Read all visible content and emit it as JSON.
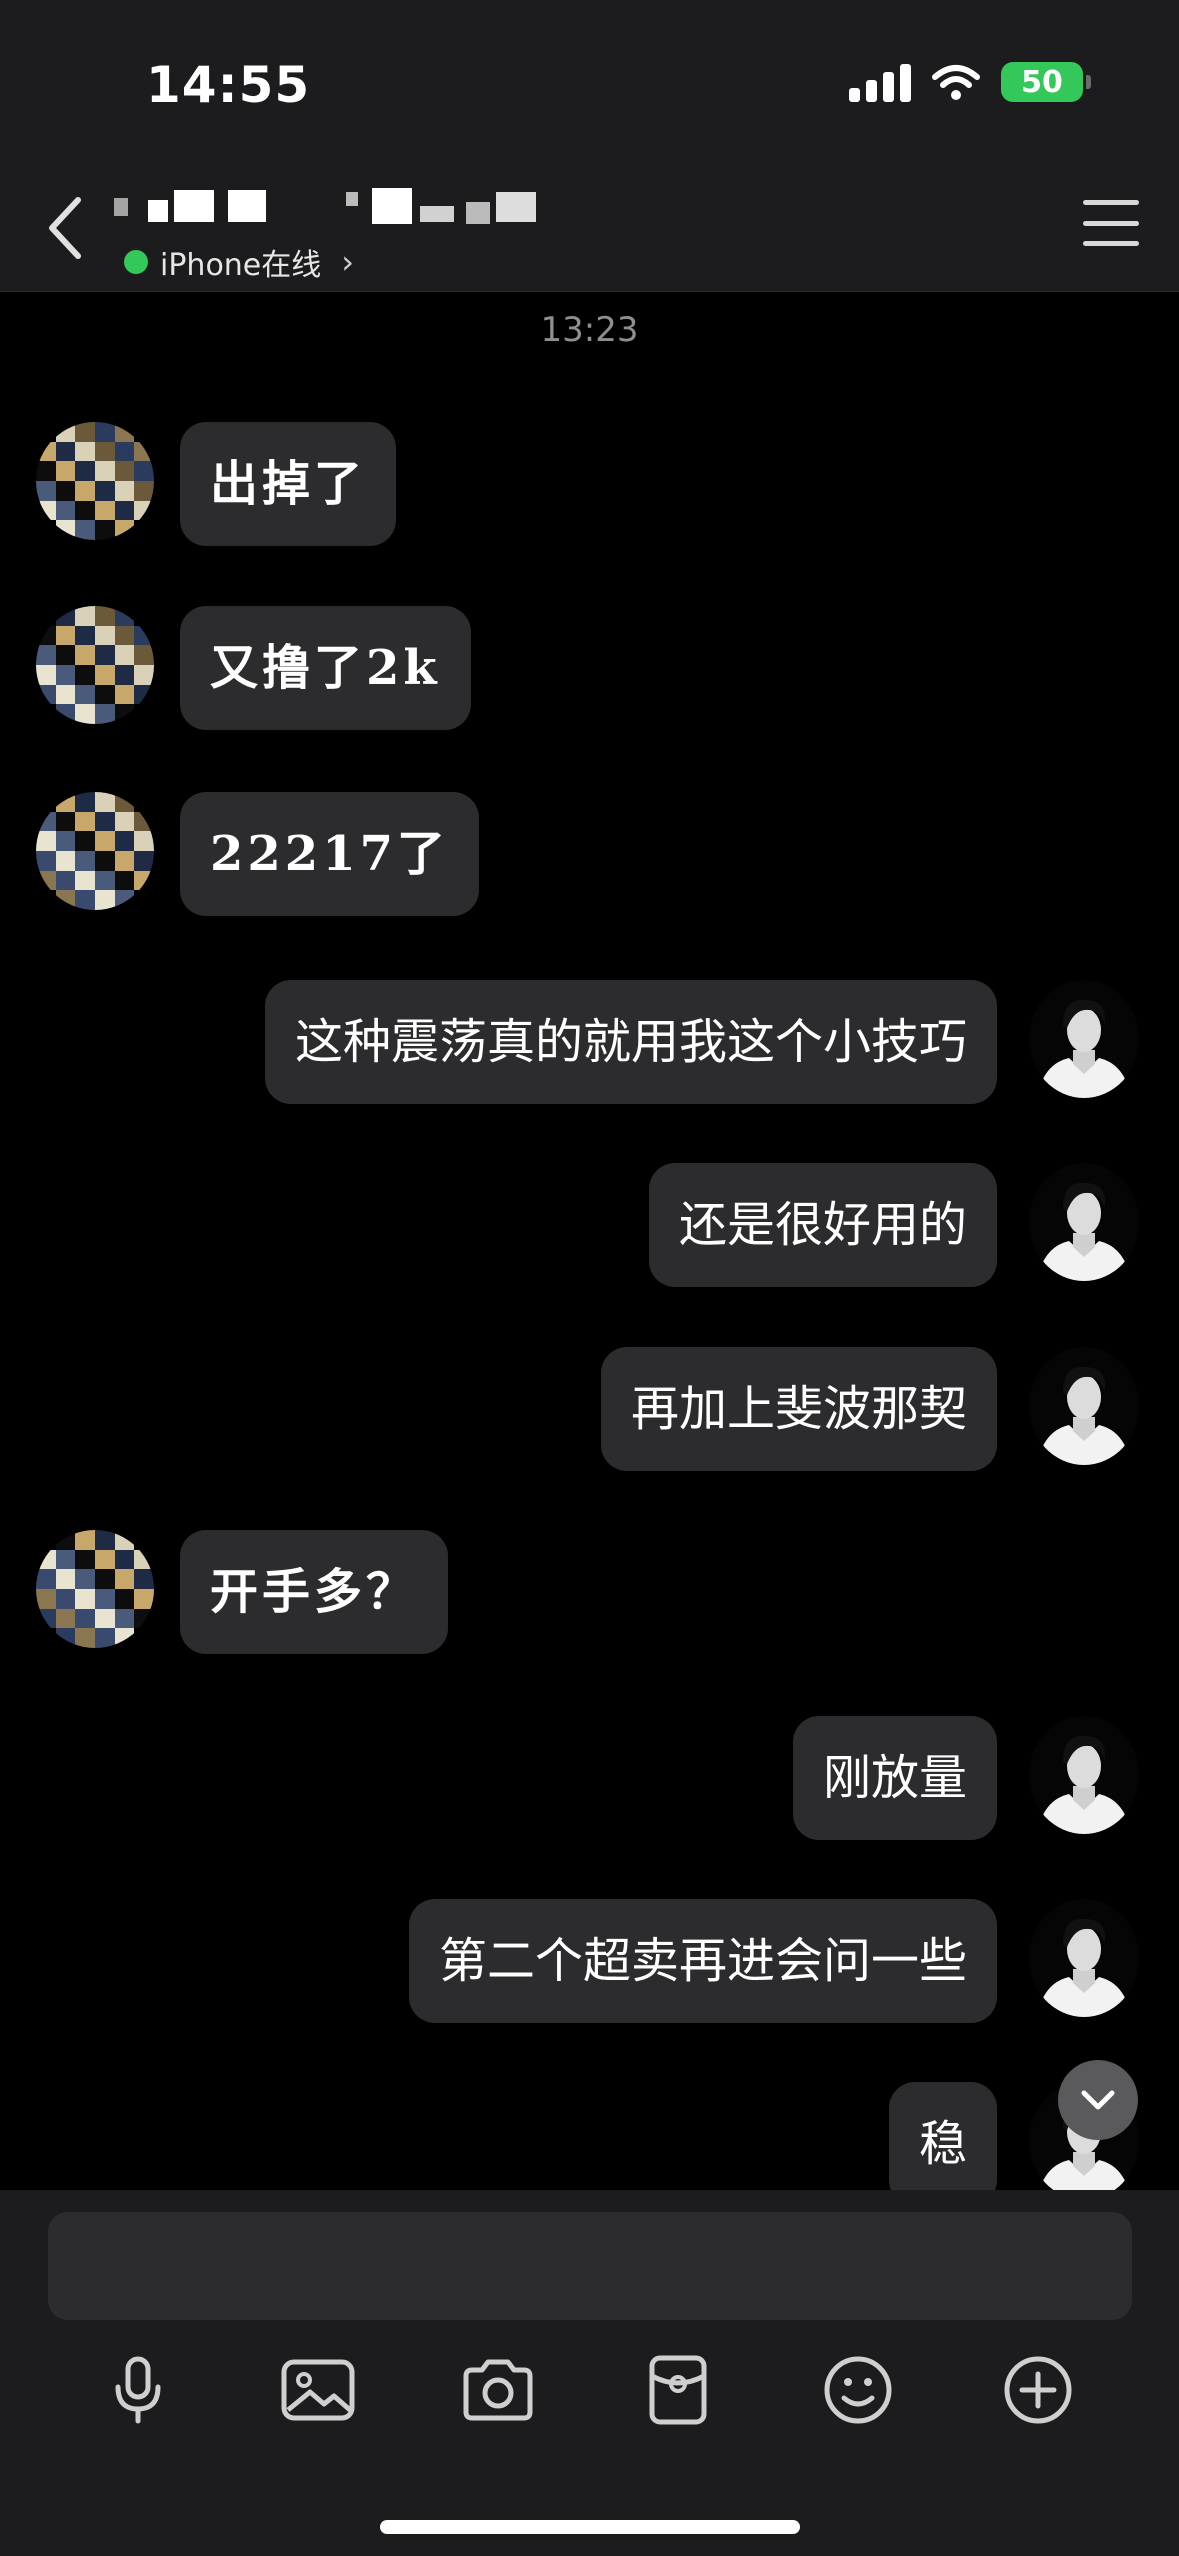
{
  "status_bar": {
    "time": "14:55",
    "battery": "50"
  },
  "header": {
    "online_status": "iPhone在线",
    "chevron": "›"
  },
  "timestamp": "13:23",
  "messages": [
    {
      "side": "left",
      "text": "出掉了"
    },
    {
      "side": "left",
      "text": "又撸了2k"
    },
    {
      "side": "left",
      "text": "22217了"
    },
    {
      "side": "right",
      "text": "这种震荡真的就用我这个小技巧"
    },
    {
      "side": "right",
      "text": "还是很好用的"
    },
    {
      "side": "right",
      "text": "再加上斐波那契"
    },
    {
      "side": "left",
      "text": "开手多？"
    },
    {
      "side": "right",
      "text": "刚放量"
    },
    {
      "side": "right",
      "text": "第二个超卖再进会问一些"
    },
    {
      "side": "right",
      "text": "稳"
    }
  ],
  "input": {
    "value": ""
  },
  "toolbar": [
    "microphone-icon",
    "image-icon",
    "camera-icon",
    "red-packet-icon",
    "emoji-icon",
    "add-icon"
  ]
}
